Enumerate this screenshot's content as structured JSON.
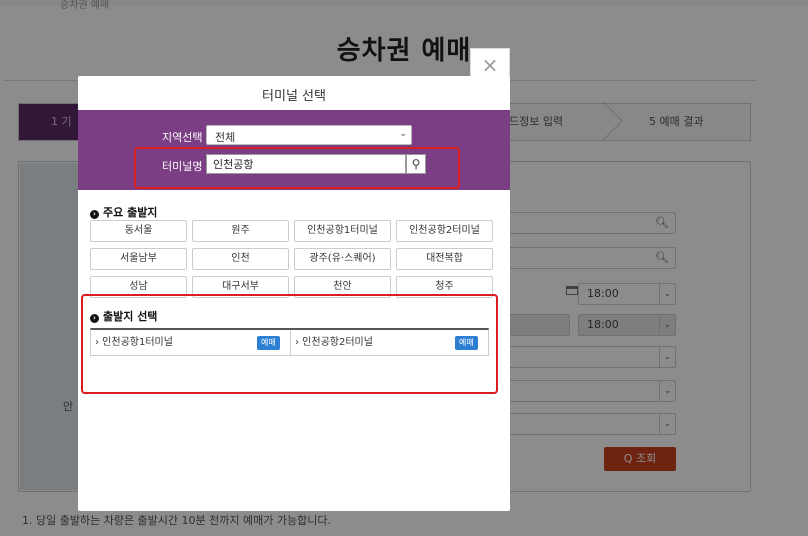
{
  "page": {
    "crumb": "승차권 예매",
    "title": "승차권 예매",
    "steps": {
      "step1": "1 기",
      "step4": "드정보 입력",
      "step5": "5 예매 결과"
    },
    "left_label": "안",
    "times": [
      "18:00",
      "18:00"
    ],
    "search_button": "Q 조회",
    "footnote": "1. 당일 출발하는 차량은 출발시간 10분 전까지 예매가 가능합니다."
  },
  "modal": {
    "close_label": "×",
    "title": "터미널 선택",
    "region_label": "지역선택",
    "region_value": "전체",
    "terminal_label": "터미널명",
    "terminal_value": "인천공항",
    "major_title": "주요 출발지",
    "major_terminals": [
      "동서울",
      "원주",
      "인천공항1터미널",
      "인천공항2터미널",
      "서울남부",
      "인천",
      "광주(유·스퀘어)",
      "대전복합",
      "성남",
      "대구서부",
      "천안",
      "청주"
    ],
    "departure_title": "출발지 선택",
    "departures": [
      {
        "name": "› 인천공항1터미널",
        "badge": "예매"
      },
      {
        "name": "› 인천공항2터미널",
        "badge": "예매"
      }
    ]
  },
  "colors": {
    "purple": "#7b3d84",
    "step_active": "#5e2a66",
    "highlight": "#d81e1e",
    "search_button": "#c9401e",
    "badge": "#2d7fd3"
  }
}
